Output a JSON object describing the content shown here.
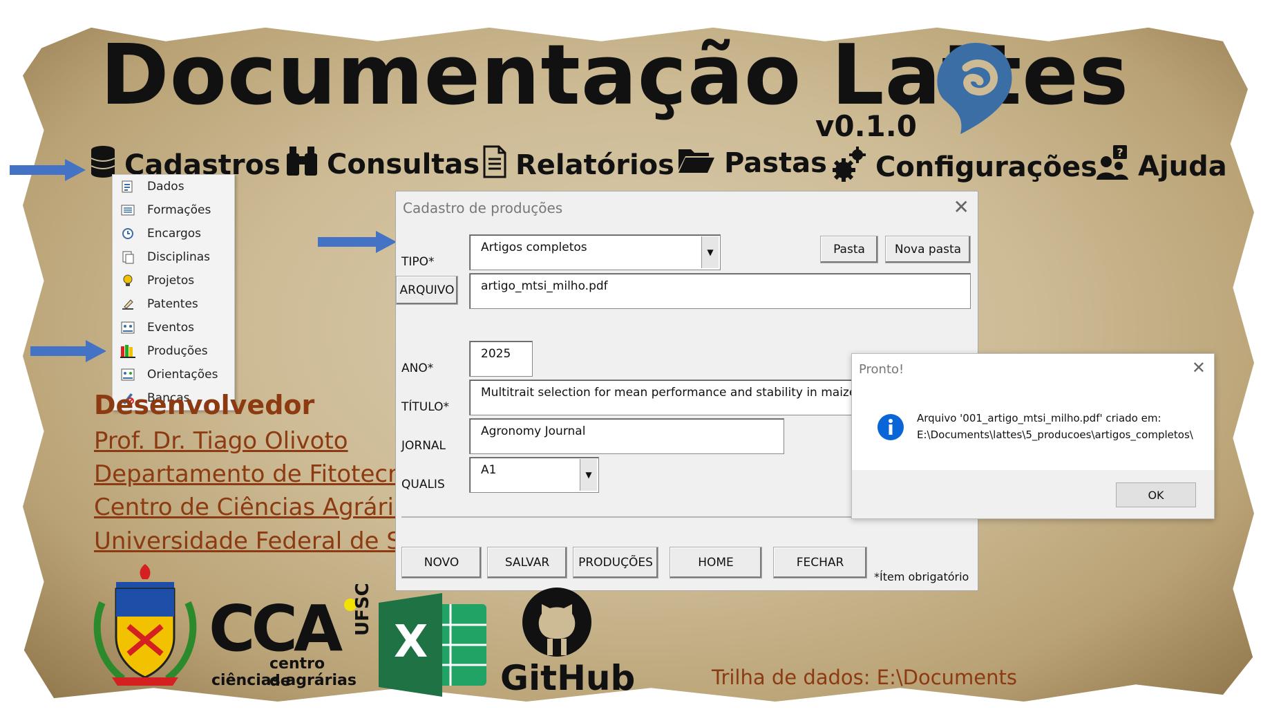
{
  "app": {
    "title": "Documentação Lattes",
    "version": "v0.1.0"
  },
  "nav": [
    {
      "label": "Cadastros",
      "icon": "database-icon"
    },
    {
      "label": "Consultas",
      "icon": "binoculars-icon"
    },
    {
      "label": "Relatórios",
      "icon": "document-icon"
    },
    {
      "label": "Pastas",
      "icon": "folder-icon"
    },
    {
      "label": "Configurações",
      "icon": "gears-icon"
    },
    {
      "label": "Ajuda",
      "icon": "help-users-icon"
    }
  ],
  "menu": {
    "items": [
      "Dados",
      "Formações",
      "Encargos",
      "Disciplinas",
      "Projetos",
      "Patentes",
      "Eventos",
      "Produções",
      "Orientações",
      "Bancas"
    ]
  },
  "developer": {
    "heading": "Desenvolvedor",
    "lines": [
      "Prof. Dr. Tiago Olivoto",
      "Departamento de Fitotecni",
      "Centro de Ciências Agrárias",
      "Universidade Federal de Sa"
    ]
  },
  "form": {
    "title": "Cadastro de produções",
    "tipo_label": "TIPO*",
    "tipo_value": "Artigos completos",
    "pasta_button": "Pasta",
    "nova_pasta_button": "Nova pasta",
    "arquivo_button": "ARQUIVO",
    "arquivo_value": "artigo_mtsi_milho.pdf",
    "ano_label": "ANO*",
    "ano_value": "2025",
    "titulo_label": "TÍTULO*",
    "titulo_value": "Multitrait selection for mean performance and stability in maize",
    "jornal_label": "JORNAL",
    "jornal_value": "Agronomy Journal",
    "qualis_label": "QUALIS",
    "qualis_value": "A1",
    "buttons": [
      "NOVO",
      "SALVAR",
      "PRODUÇÕES",
      "HOME",
      "FECHAR"
    ],
    "required_note": "*Ítem obrigatório"
  },
  "dialog": {
    "title": "Pronto!",
    "message_line1": "Arquivo '001_artigo_mtsi_milho.pdf' criado em:",
    "message_line2": "E:\\Documents\\lattes\\5_producoes\\artigos_completos\\",
    "ok": "OK"
  },
  "logos": {
    "cca_text": "CCA",
    "cca_sub1": "centro de",
    "cca_sub2": "ciências agrárias",
    "ufsc": "UFSC",
    "excel_letter": "X",
    "github": "GitHub"
  },
  "footer": {
    "trilha": "Trilha de dados:  E:\\Documents"
  },
  "colors": {
    "arrow": "#4472c4",
    "accent_brown": "#8b3a12",
    "lattes_blue": "#3a6ea5",
    "excel_green": "#1f7244"
  }
}
